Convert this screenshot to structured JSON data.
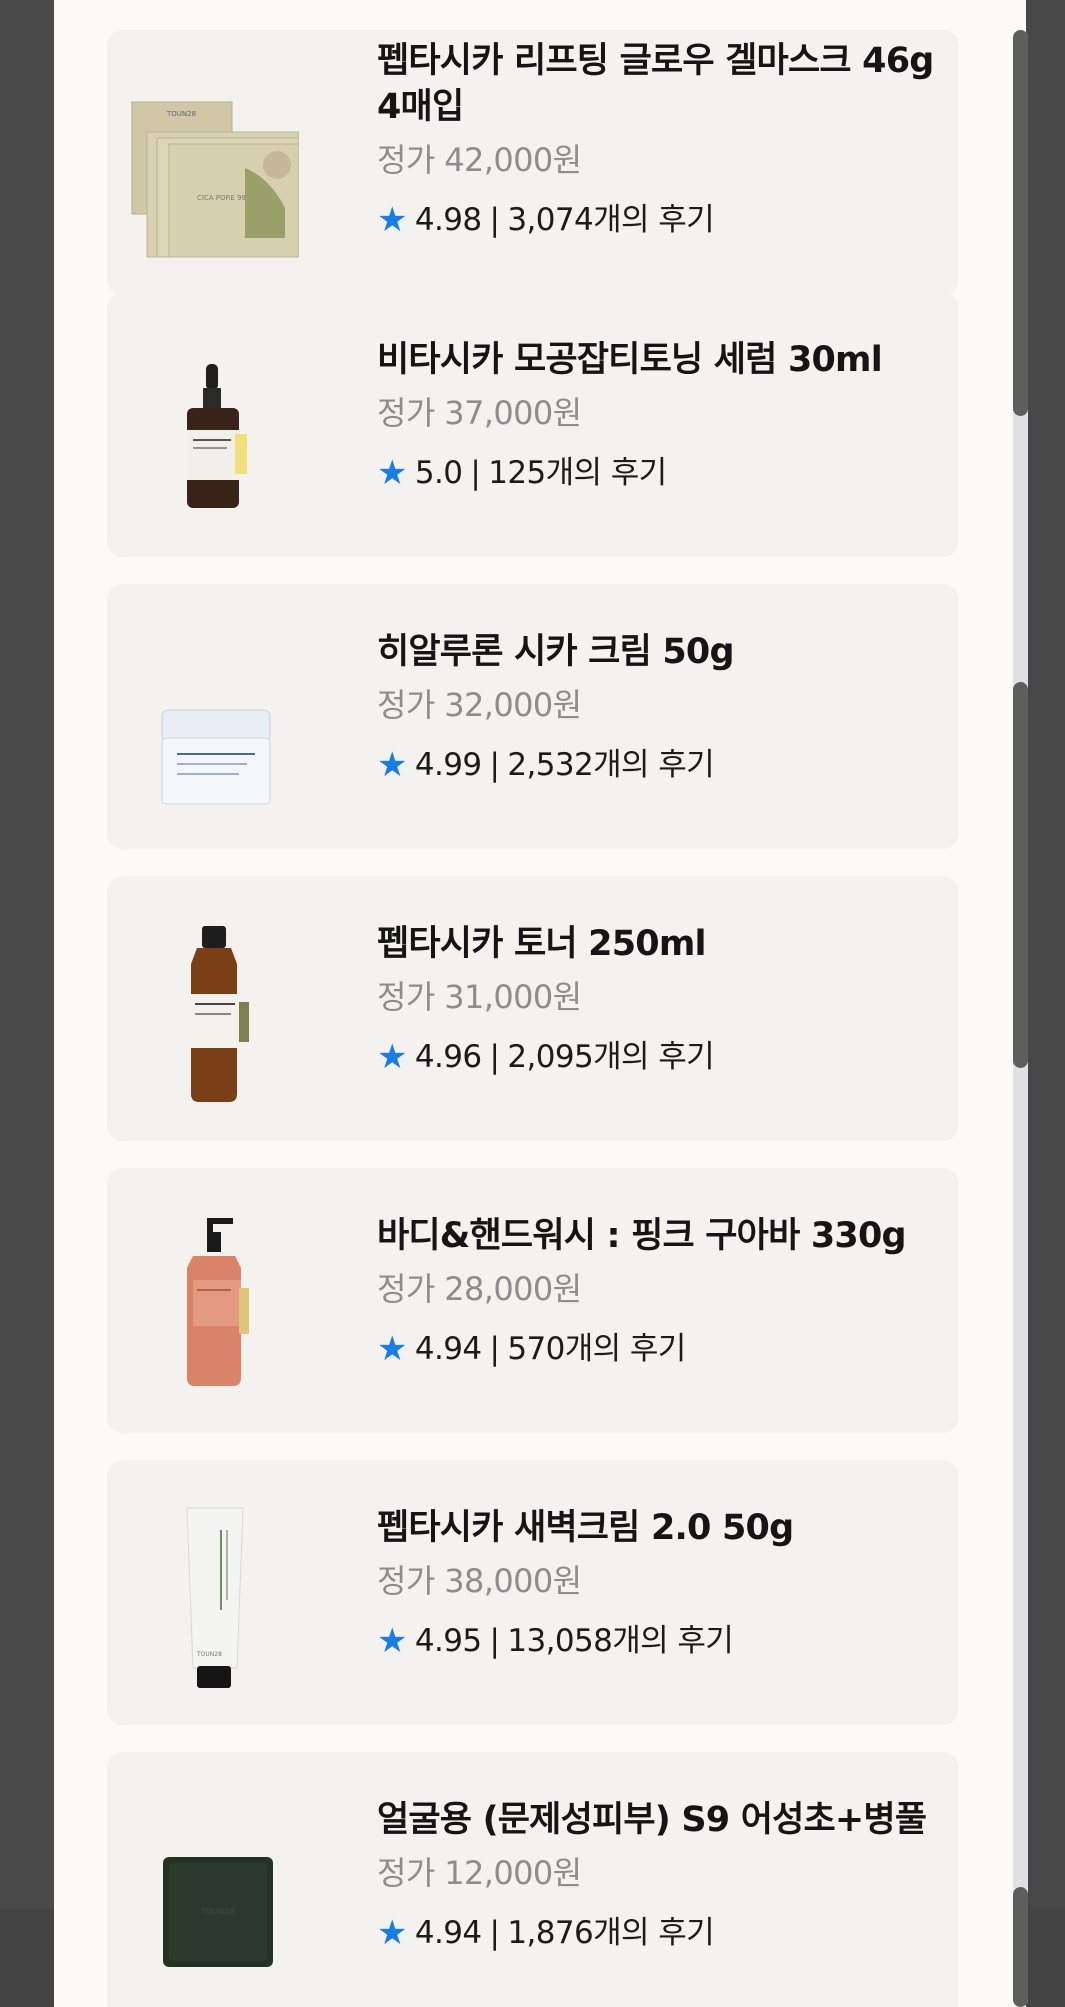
{
  "products": [
    {
      "name": "펩타시카 리프팅 글로우 겔마스크 46g 4매입",
      "price": "정가 42,000원",
      "score": "4.98",
      "reviews": "3,074개의 후기",
      "image": "gel-mask-pack-image"
    },
    {
      "name": "비타시카 모공잡티토닝 세럼 30ml",
      "price": "정가 37,000원",
      "score": "5.0",
      "reviews": "125개의 후기",
      "image": "serum-dropper-bottle-image"
    },
    {
      "name": "히알루론 시카 크림 50g",
      "price": "정가 32,000원",
      "score": "4.99",
      "reviews": "2,532개의 후기",
      "image": "cream-jar-image"
    },
    {
      "name": "펩타시카 토너 250ml",
      "price": "정가 31,000원",
      "score": "4.96",
      "reviews": "2,095개의 후기",
      "image": "toner-bottle-image"
    },
    {
      "name": "바디&핸드워시 : 핑크 구아바 330g",
      "price": "정가 28,000원",
      "score": "4.94",
      "reviews": "570개의 후기",
      "image": "pump-bottle-image"
    },
    {
      "name": "펩타시카 새벽크림 2.0 50g",
      "price": "정가 38,000원",
      "score": "4.95",
      "reviews": "13,058개의 후기",
      "image": "cream-tube-image"
    },
    {
      "name": "얼굴용 (문제성피부) S9 어성초+병풀",
      "price": "정가 12,000원",
      "score": "4.94",
      "reviews": "1,876개의 후기",
      "image": "soap-bar-image"
    }
  ],
  "rating_separator": "|",
  "colors": {
    "star": "#1a7ce6",
    "card_bg": "#f4f2ef",
    "sheet_bg": "#fbfaf7",
    "price": "#8d8d8d"
  }
}
